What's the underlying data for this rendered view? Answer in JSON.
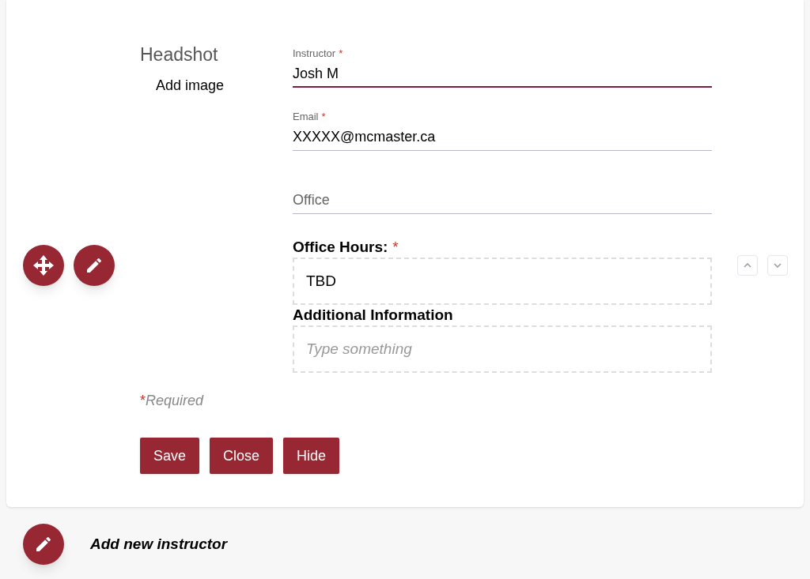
{
  "headshot": {
    "title": "Headshot",
    "add_image": "Add image"
  },
  "fields": [
    {
      "kind": "text",
      "label": "Instructor",
      "required_mark": "*",
      "value": "Josh M",
      "focused": true
    },
    {
      "kind": "text",
      "label": "Email",
      "required_mark": "*",
      "value": "XXXXX@mcmaster.ca",
      "focused": false
    },
    {
      "kind": "text",
      "placeholder": "Office",
      "focused": false
    },
    {
      "kind": "editor",
      "label": "Office Hours:",
      "required_mark": "*",
      "value": "TBD"
    },
    {
      "kind": "editor",
      "label": "Additional Information",
      "placeholder": "Type something"
    }
  ],
  "required_note": {
    "mark": "*",
    "text": "Required"
  },
  "buttons": [
    "Save",
    "Close",
    "Hide"
  ],
  "add_new": "Add new instructor"
}
